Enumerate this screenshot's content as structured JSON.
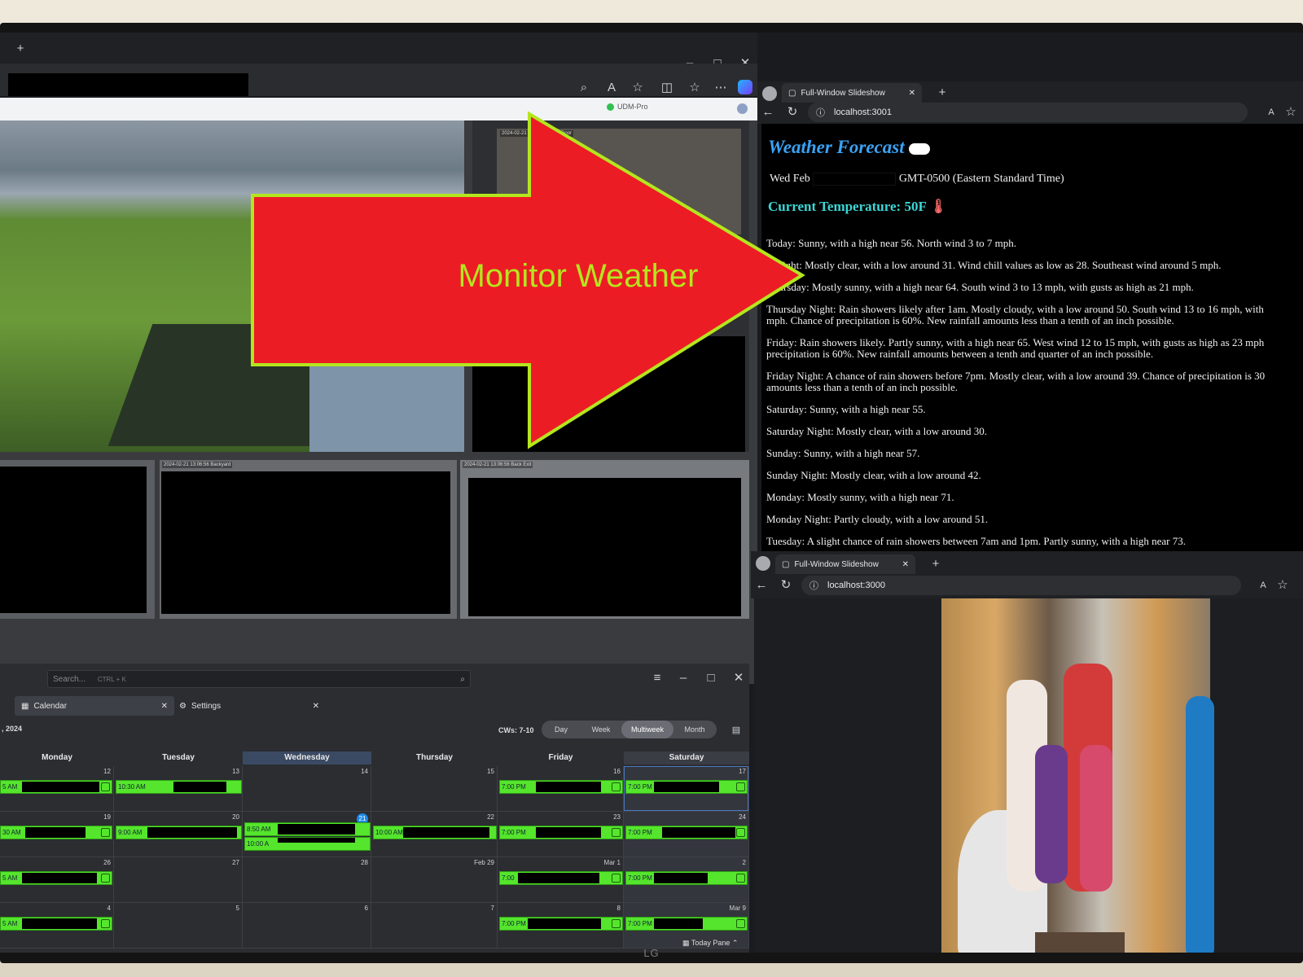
{
  "left_browser": {
    "new_tab_glyph": "+",
    "window_controls": [
      "–",
      "□",
      "✕"
    ],
    "toolbar_icons": [
      "zoom-icon",
      "read-aloud-icon",
      "favorite-icon",
      "split-screen-icon",
      "favorites-bar-icon",
      "more-icon",
      "copilot-icon"
    ],
    "unifi_device": "UDM-Pro"
  },
  "cameras": [
    {
      "label": "2024-02-21 13:06:56 Front Door"
    },
    {
      "label": "2024-02-21 13:06:56 Backyard"
    },
    {
      "label": "2024-02-21 13:06:56 Back Exit"
    }
  ],
  "annotation": {
    "text": "Monitor Weather",
    "fill": "#ec1c24",
    "stroke": "#b4e61e"
  },
  "weather_browser": {
    "tab_title": "Full-Window Slideshow",
    "url": "localhost:3001",
    "title": "Weather Forecast",
    "date_prefix": "Wed Feb",
    "date_suffix": "GMT-0500 (Eastern Standard Time)",
    "current": "Current Temperature: 50F",
    "lines": [
      "Today: Sunny, with a high near 56. North wind 3 to 7 mph.",
      "Tonight: Mostly clear, with a low around 31. Wind chill values as low as 28. Southeast wind around 5 mph.",
      "Thursday: Mostly sunny, with a high near 64. South wind 3 to 13 mph, with gusts as high as 21 mph.",
      "Thursday Night: Rain showers likely after 1am. Mostly cloudy, with a low around 50. South wind 13 to 16 mph, with",
      "mph. Chance of precipitation is 60%. New rainfall amounts less than a tenth of an inch possible.",
      "Friday: Rain showers likely. Partly sunny, with a high near 65. West wind 12 to 15 mph, with gusts as high as 23 mph",
      "precipitation is 60%. New rainfall amounts between a tenth and quarter of an inch possible.",
      "Friday Night: A chance of rain showers before 7pm. Mostly clear, with a low around 39. Chance of precipitation is 30",
      "amounts less than a tenth of an inch possible.",
      "Saturday: Sunny, with a high near 55.",
      "Saturday Night: Mostly clear, with a low around 30.",
      "Sunday: Sunny, with a high near 57.",
      "Sunday Night: Mostly clear, with a low around 42.",
      "Monday: Mostly sunny, with a high near 71.",
      "Monday Night: Partly cloudy, with a low around 51.",
      "Tuesday: A slight chance of rain showers between 7am and 1pm. Partly sunny, with a high near 73."
    ]
  },
  "photo_browser": {
    "tab_title": "Full-Window Slideshow",
    "url": "localhost:3000"
  },
  "calendar": {
    "search_placeholder": "Search...",
    "search_shortcut": "CTRL + K",
    "tabs": [
      "Calendar",
      "Settings"
    ],
    "year_label": ", 2024",
    "cw_label": "CWs: 7-10",
    "views": [
      "Day",
      "Week",
      "Multiweek",
      "Month"
    ],
    "active_view": "Multiweek",
    "days": [
      "Monday",
      "Tuesday",
      "Wednesday",
      "Thursday",
      "Friday",
      "Saturday"
    ],
    "weeks": [
      [
        "12",
        "13",
        "14",
        "15",
        "16",
        "17"
      ],
      [
        "19",
        "20",
        "21",
        "22",
        "23",
        "24"
      ],
      [
        "26",
        "27",
        "28",
        "Feb 29",
        "Mar 1",
        "2"
      ],
      [
        "4",
        "5",
        "6",
        "7",
        "8",
        "Mar 9"
      ]
    ],
    "today_label": "21",
    "events": {
      "tuesday_w1": "10:30 AM",
      "friday_w1": "7:00 PM",
      "saturday_w1": "7:00 PM",
      "monday_w2": "30 AM",
      "tuesday_w2": "9:00 AM",
      "wednesday_w2a": "8:50 AM",
      "wednesday_w2b": "10:00 A",
      "thursday_w2": "10:00 AM",
      "friday_w2": "7:00 PM",
      "saturday_w2": "7:00 PM",
      "friday_w3": "7:00",
      "saturday_w3": "7:00 PM",
      "friday_w4": "7:00 PM",
      "saturday_w4": "7:00 PM",
      "monday_w1": "5 AM",
      "monday_w3": "5 AM",
      "monday_w4": "5 AM"
    },
    "today_pane": "Today Pane"
  },
  "tv_brand": "LG"
}
